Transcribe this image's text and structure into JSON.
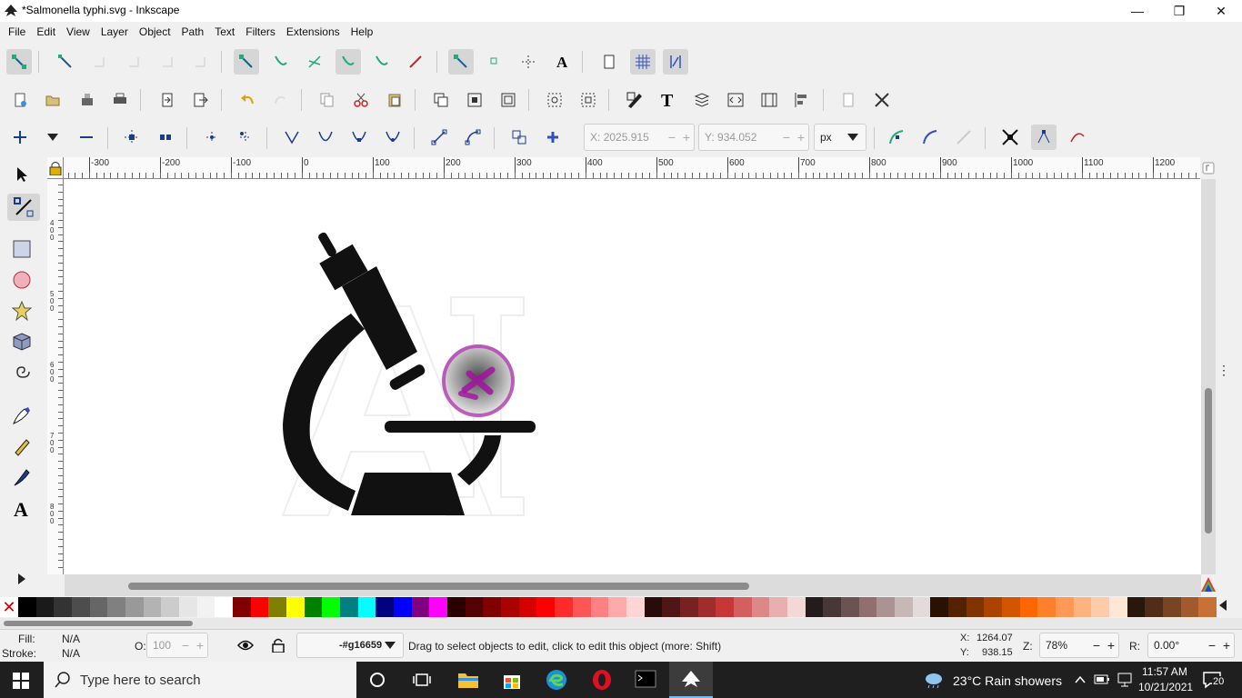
{
  "window": {
    "title": "*Salmonella typhi.svg - Inkscape"
  },
  "menu": [
    "File",
    "Edit",
    "View",
    "Layer",
    "Object",
    "Path",
    "Text",
    "Filters",
    "Extensions",
    "Help"
  ],
  "node_toolbar": {
    "x_label": "X:",
    "x_value": "2025.915",
    "y_label": "Y:",
    "y_value": "934.052",
    "unit": "px"
  },
  "ruler": {
    "labels": [
      "-300",
      "-200",
      "-100",
      "0",
      "100",
      "200",
      "300",
      "400",
      "500",
      "600",
      "700",
      "800",
      "900",
      "1000",
      "1100",
      "1200"
    ],
    "vlabels": [
      "400",
      "500",
      "600",
      "700",
      "800"
    ]
  },
  "palette": [
    "#000000",
    "#1a1a1a",
    "#333333",
    "#4d4d4d",
    "#666666",
    "#808080",
    "#999999",
    "#b3b3b3",
    "#cccccc",
    "#e6e6e6",
    "#f2f2f2",
    "#ffffff",
    "#800000",
    "#ff0000",
    "#808000",
    "#ffff00",
    "#008000",
    "#00ff00",
    "#008080",
    "#00ffff",
    "#000080",
    "#0000ff",
    "#800080",
    "#ff00ff",
    "#2b0000",
    "#550000",
    "#800000",
    "#aa0000",
    "#d40000",
    "#ff0000",
    "#ff2a2a",
    "#ff5555",
    "#ff8080",
    "#ffaaaa",
    "#ffd5d5",
    "#280b0b",
    "#501616",
    "#782121",
    "#a02c2c",
    "#c83737",
    "#d35f5f",
    "#de8787",
    "#e9afaf",
    "#f4d7d7",
    "#241c1c",
    "#483737",
    "#6c5353",
    "#916f6f",
    "#ac9393",
    "#c8b7b7",
    "#e3dbdb",
    "#2b1100",
    "#552200",
    "#803300",
    "#aa4400",
    "#d45500",
    "#ff6600",
    "#ff7f2a",
    "#ff9955",
    "#ffb380",
    "#ffccaa",
    "#ffe6d5",
    "#28170b",
    "#502d16",
    "#784421",
    "#a05a2c",
    "#c87137"
  ],
  "status": {
    "fill_label": "Fill:",
    "fill_value": "N/A",
    "stroke_label": "Stroke:",
    "stroke_value": "N/A",
    "opacity_label": "O:",
    "opacity_value": "100",
    "layer": "-#g16659",
    "message": "Drag to select objects to edit, click to edit this object (more: Shift)",
    "cursor_x_label": "X:",
    "cursor_x": "1264.07",
    "cursor_y_label": "Y:",
    "cursor_y": "938.15",
    "zoom_label": "Z:",
    "zoom": "78%",
    "rotate_label": "R:",
    "rotate": "0.00°"
  },
  "taskbar": {
    "search_placeholder": "Type here to search",
    "weather": "23°C  Rain showers",
    "time": "11:57 AM",
    "date": "10/21/2021",
    "notifications": "20"
  },
  "colors": {
    "chrome": "#f0f0f0",
    "canvas": "#ffffff",
    "taskbar": "#1f1f1f",
    "accent": "#1e90ff"
  }
}
